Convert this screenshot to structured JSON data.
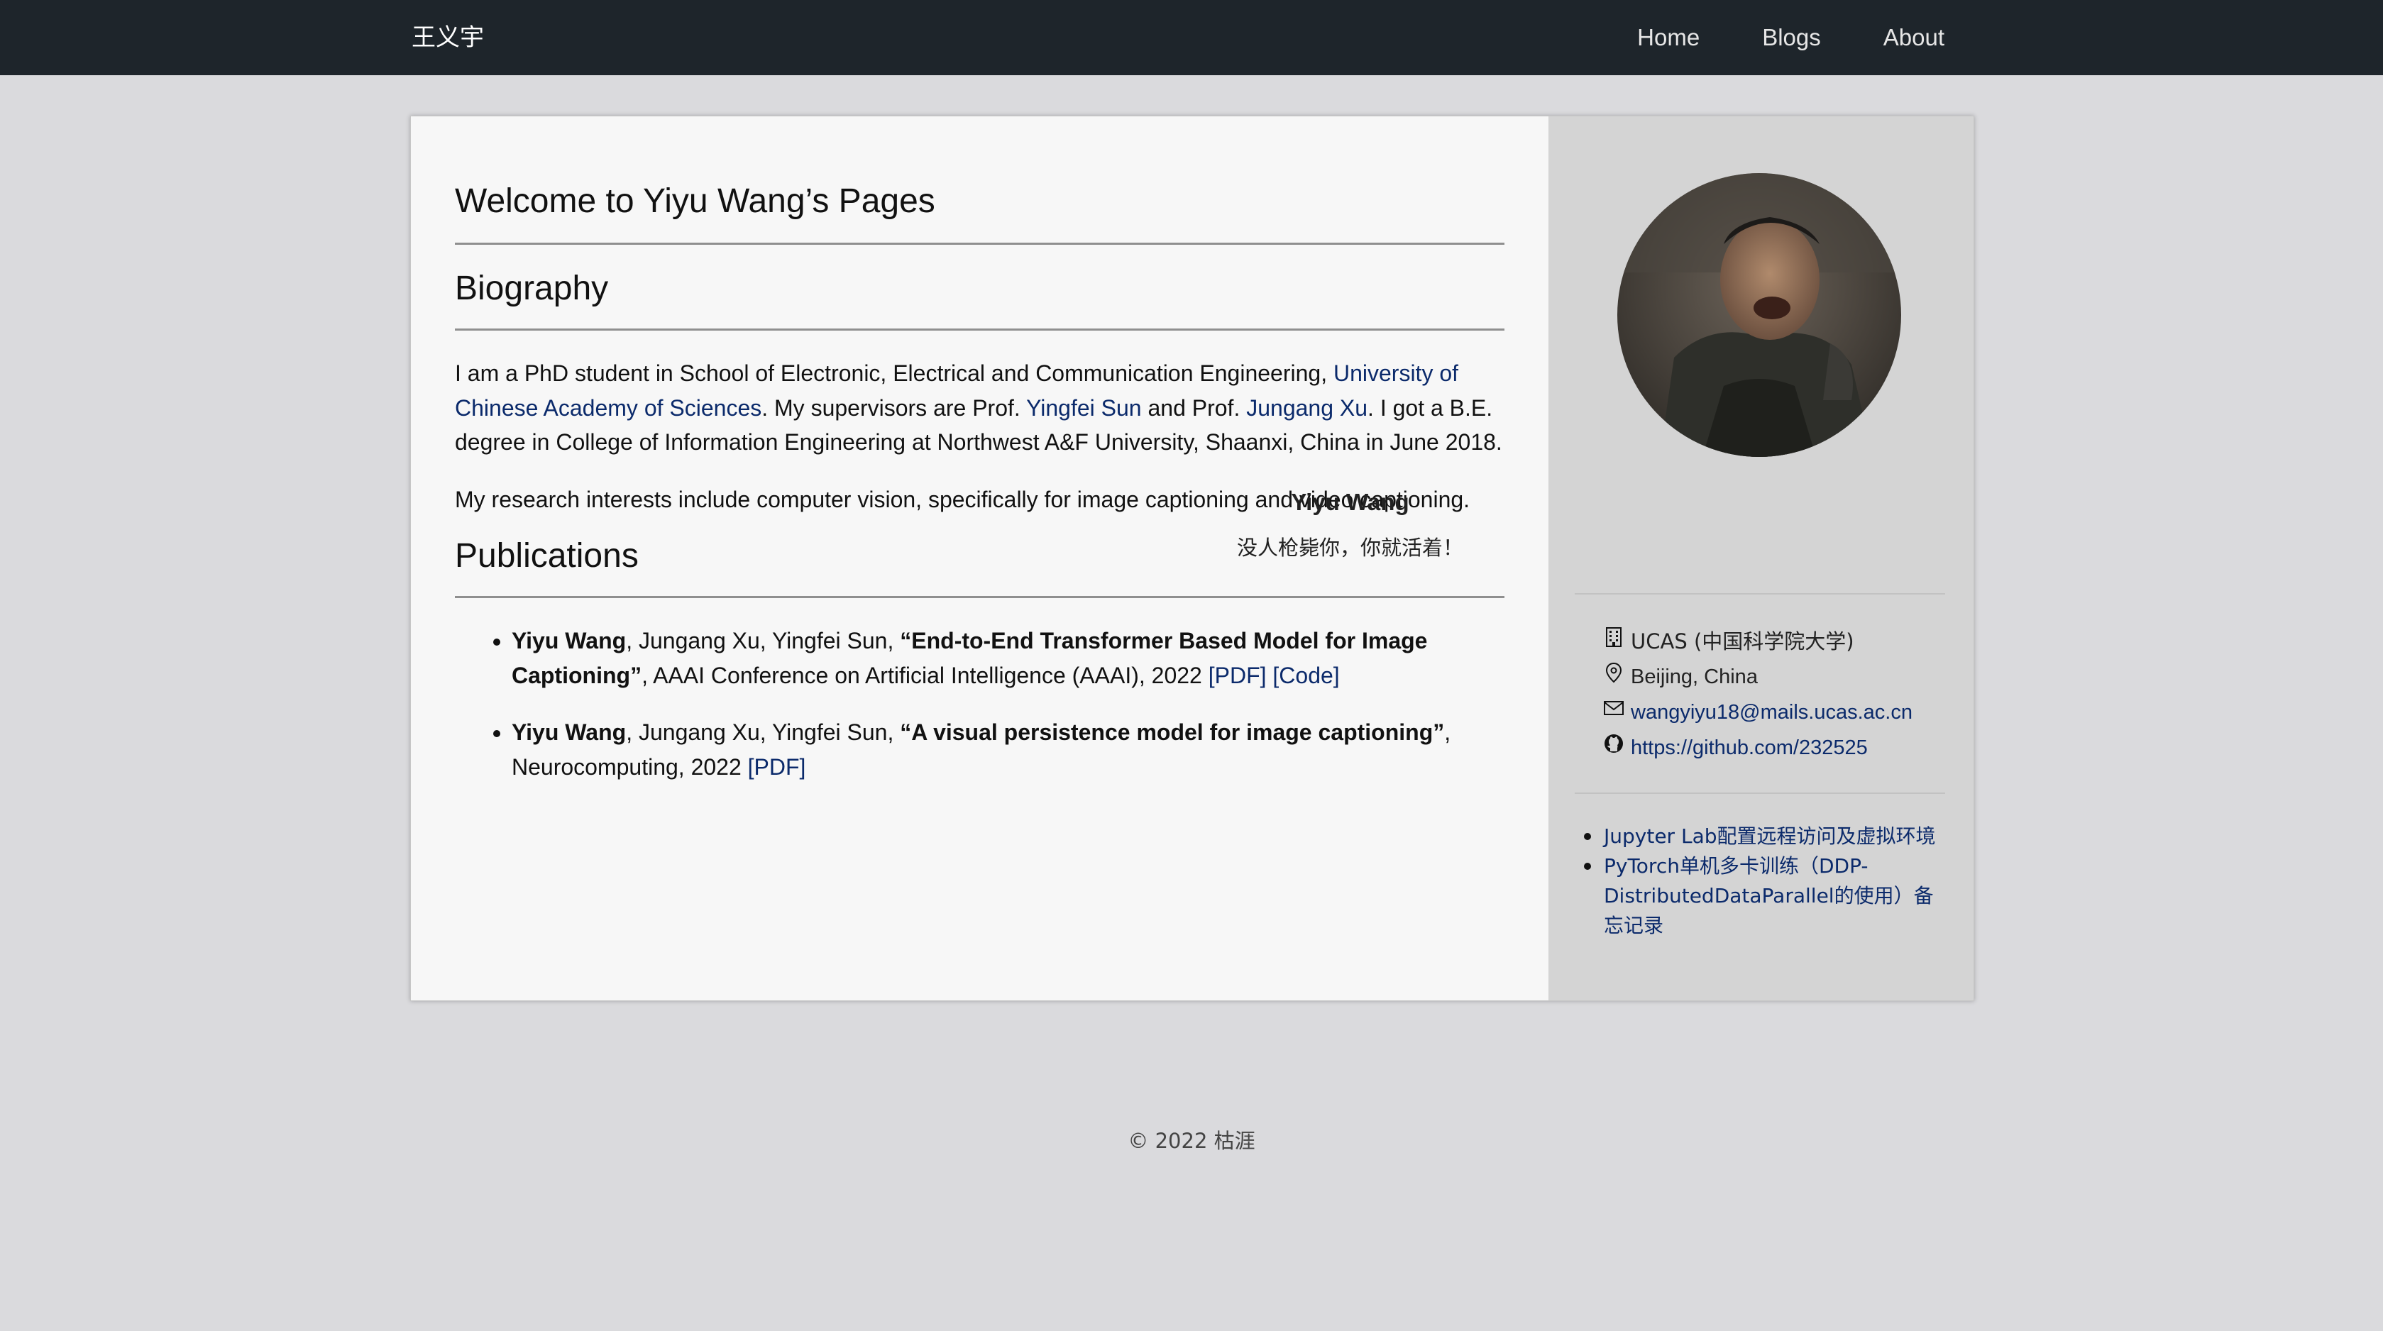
{
  "nav": {
    "brand": "王义宇",
    "links": [
      "Home",
      "Blogs",
      "About"
    ]
  },
  "main": {
    "title": "Welcome to Yiyu Wang’s Pages",
    "biography_heading": "Biography",
    "bio": {
      "t1": "I am a PhD student in School of Electronic, Electrical and Communication Engineering, ",
      "ucas_link": "University of Chinese Academy of Sciences",
      "t2": ". My supervisors are Prof. ",
      "sup1_link": "Yingfei Sun",
      "t3": " and Prof. ",
      "sup2_link": "Jungang Xu",
      "t4": ". I got a B.E. degree in College of Information Engineering at Northwest A&F University, Shaanxi, China in June 2018."
    },
    "research": "My research interests include computer vision, specifically for image captioning and video captioning.",
    "publications_heading": "Publications",
    "publications": [
      {
        "first_author": "Yiyu Wang",
        "coauthors": ", Jungang Xu, Yingfei Sun, ",
        "title": "“End-to-End Transformer Based Model for Image Captioning”",
        "venue": ", AAAI Conference on Artificial Intelligence (AAAI), 2022 ",
        "pdf": "[PDF]",
        "code": "[Code]"
      },
      {
        "first_author": "Yiyu Wang",
        "coauthors": ", Jungang Xu, Yingfei Sun, ",
        "title": "“A visual persistence model for image captioning”",
        "venue": ", Neurocomputing, 2022 ",
        "pdf": "[PDF]"
      }
    ]
  },
  "sidebar": {
    "name": "Yiyu Wang",
    "motto": "没人枪毙你，你就活着！",
    "info": [
      {
        "icon": "building-icon",
        "text": "UCAS (中国科学院大学)"
      },
      {
        "icon": "location-icon",
        "text": "Beijing, China"
      },
      {
        "icon": "mail-icon",
        "text": "wangyiyu18@mails.ucas.ac.cn"
      },
      {
        "icon": "github-icon",
        "text": "https://github.com/232525"
      }
    ],
    "posts": [
      "Jupyter Lab配置远程访问及虚拟环境",
      "PyTorch单机多卡训练（DDP-DistributedDataParallel的使用）备忘记录"
    ]
  },
  "footer": "© 2022 枯涯",
  "colors": {
    "navbar_bg": "#1e252b",
    "page_bg": "#dadadd",
    "content_bg": "#f7f7f7",
    "sidebar_bg": "#d4d4d4",
    "link": "#0b2a6b"
  }
}
